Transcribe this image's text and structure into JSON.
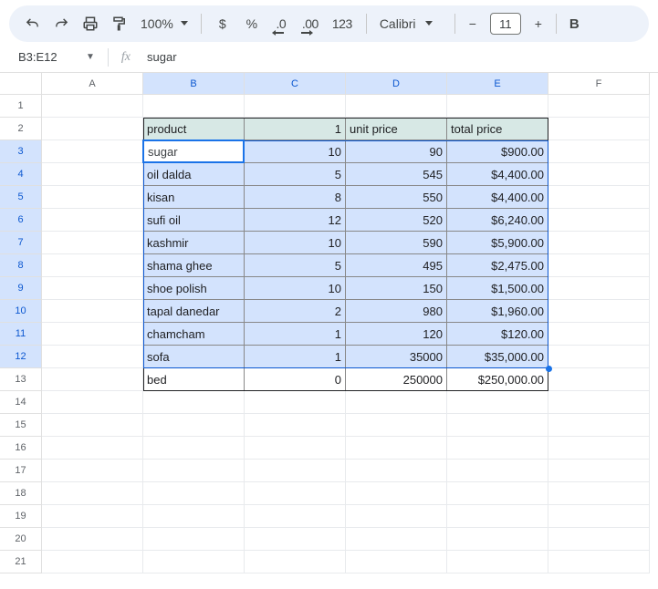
{
  "toolbar": {
    "zoom": "100%",
    "currency": "$",
    "percent": "%",
    "dec_dec": ".0",
    "dec_inc": ".00",
    "num_format": "123",
    "font": "Calibri",
    "font_size": "11",
    "bold": "B"
  },
  "namebox": {
    "range": "B3:E12",
    "formula": "sugar"
  },
  "columns": [
    "A",
    "B",
    "C",
    "D",
    "E",
    "F"
  ],
  "selected_cols": [
    "B",
    "C",
    "D",
    "E"
  ],
  "rows": [
    "1",
    "2",
    "3",
    "4",
    "5",
    "6",
    "7",
    "8",
    "9",
    "10",
    "11",
    "12",
    "13",
    "14",
    "15",
    "16",
    "17",
    "18",
    "19",
    "20",
    "21"
  ],
  "selected_rows": [
    "3",
    "4",
    "5",
    "6",
    "7",
    "8",
    "9",
    "10",
    "11",
    "12"
  ],
  "active_cell_value": "sugar",
  "table": {
    "header": {
      "b": "product",
      "c": "1",
      "d": "unit price",
      "e": "total price"
    },
    "rows": [
      {
        "b": "sugar",
        "c": "10",
        "d": "90",
        "e": "$900.00"
      },
      {
        "b": "oil dalda",
        "c": "5",
        "d": "545",
        "e": "$4,400.00"
      },
      {
        "b": "kisan",
        "c": "8",
        "d": "550",
        "e": "$4,400.00"
      },
      {
        "b": "sufi oil",
        "c": "12",
        "d": "520",
        "e": "$6,240.00"
      },
      {
        "b": "kashmir",
        "c": "10",
        "d": "590",
        "e": "$5,900.00"
      },
      {
        "b": "shama ghee",
        "c": "5",
        "d": "495",
        "e": "$2,475.00"
      },
      {
        "b": "shoe polish",
        "c": "10",
        "d": "150",
        "e": "$1,500.00"
      },
      {
        "b": "tapal danedar",
        "c": "2",
        "d": "980",
        "e": "$1,960.00"
      },
      {
        "b": "chamcham",
        "c": "1",
        "d": "120",
        "e": "$120.00"
      },
      {
        "b": "sofa",
        "c": "1",
        "d": "35000",
        "e": "$35,000.00"
      },
      {
        "b": "bed",
        "c": "0",
        "d": "250000",
        "e": "$250,000.00"
      }
    ]
  }
}
